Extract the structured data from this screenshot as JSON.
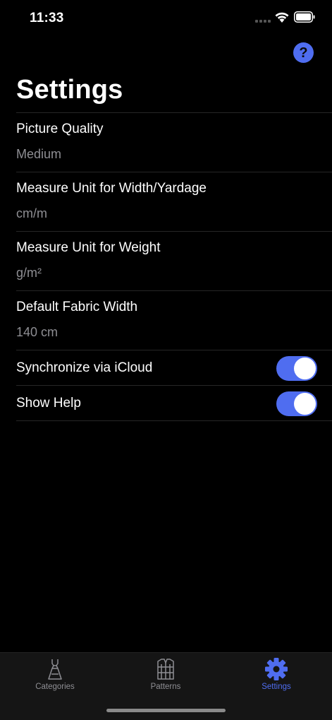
{
  "status_bar": {
    "time": "11:33"
  },
  "header": {
    "title": "Settings",
    "help_icon": "help-circle-icon",
    "help_glyph": "?"
  },
  "settings": [
    {
      "label": "Picture Quality",
      "value": "Medium"
    },
    {
      "label": "Measure Unit for Width/Yardage",
      "value": "cm/m"
    },
    {
      "label": "Measure Unit for Weight",
      "value": "g/m²"
    },
    {
      "label": "Default Fabric Width",
      "value": "140 cm"
    }
  ],
  "toggles": [
    {
      "label": "Synchronize via iCloud",
      "on": true
    },
    {
      "label": "Show Help",
      "on": true
    }
  ],
  "tab_bar": {
    "tabs": [
      {
        "label": "Categories",
        "icon": "dress-icon",
        "active": false
      },
      {
        "label": "Patterns",
        "icon": "vest-icon",
        "active": false
      },
      {
        "label": "Settings",
        "icon": "gear-icon",
        "active": true
      }
    ]
  },
  "colors": {
    "accent": "#4f6df0",
    "background": "#000000",
    "secondary_text": "#8e8e93"
  }
}
